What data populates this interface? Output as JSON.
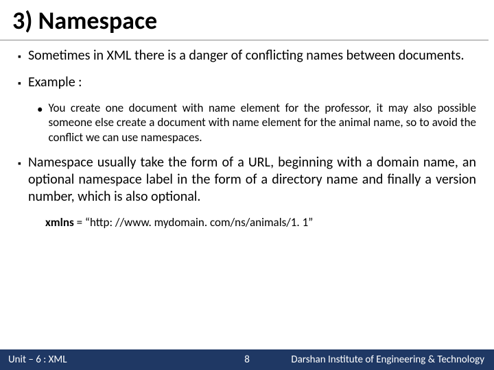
{
  "title": "3) Namespace",
  "bullets": {
    "b1": "Sometimes in XML there is a danger of conflicting names between documents.",
    "b2": "Example :",
    "b2a": "You create one document with name element for the professor, it may also possible someone else create a document with name element for the animal name, so to avoid the conflict we can use namespaces.",
    "b3": "Namespace usually take the form of a URL, beginning with a domain name, an optional namespace label in the form of a directory name and finally a version number, which is also optional."
  },
  "code": {
    "keyword": "xmlns",
    "rest": " = “http: //www. mydomain. com/ns/animals/1. 1”"
  },
  "footer": {
    "left": "Unit – 6 : XML",
    "page": "8",
    "right": "Darshan Institute of Engineering & Technology"
  }
}
